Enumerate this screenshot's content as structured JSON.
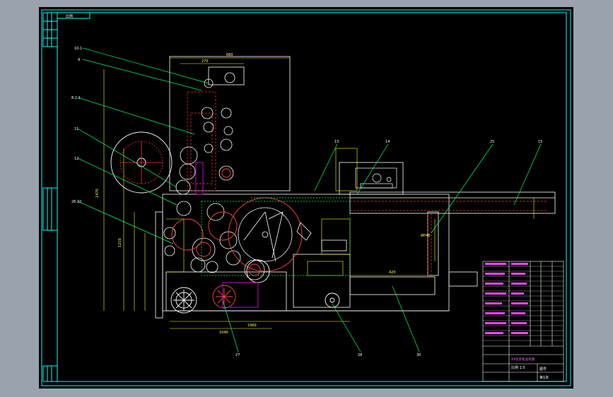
{
  "sheet": {
    "top_left_box": "比例",
    "colors": {
      "background": "#000000",
      "frame": "#00ffff",
      "outline": "#ffffff",
      "dimension": "#ffff00",
      "leader": "#00ff66",
      "hidden": "#ff3333",
      "part": "#ff00ff",
      "gear": "#ff4444"
    }
  },
  "title_block": {
    "drawing_name": "XX包装机总装图",
    "scale_text": "比例 1:5",
    "drawing_no": "图号",
    "sheet_text": "第1张"
  },
  "balloons": [
    "10-1",
    "9",
    "8.2.1",
    "11",
    "12",
    "26.22",
    "13",
    "14",
    "25",
    "15",
    "27",
    "28",
    "30"
  ]
}
